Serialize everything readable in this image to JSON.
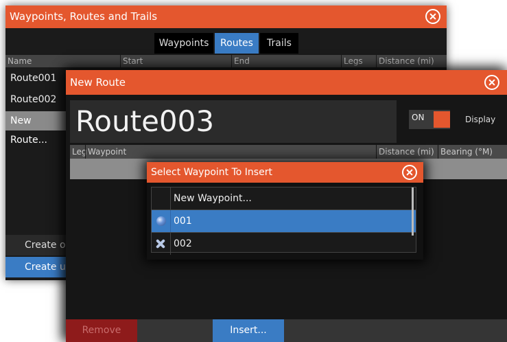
{
  "routes_dialog": {
    "title": "Waypoints, Routes and Trails",
    "tabs": [
      "Waypoints",
      "Routes",
      "Trails"
    ],
    "active_tab": "Routes",
    "columns": [
      "Name",
      "Start",
      "End",
      "Legs",
      "Distance (mi)"
    ],
    "routes": [
      "Route001",
      "Route002",
      "New Route..."
    ],
    "buttons": [
      "Create o",
      "Create u"
    ]
  },
  "new_route": {
    "title": "New Route",
    "route_name": "Route003",
    "toggle_label": "ON",
    "display_label": "Display",
    "columns": [
      "Leg",
      "Waypoint",
      "Distance (mi)",
      "Bearing (°M)"
    ],
    "remove_label": "Remove",
    "insert_label": "Insert..."
  },
  "select_waypoint": {
    "title": "Select Waypoint To Insert",
    "items": [
      {
        "label": "New Waypoint...",
        "icon": ""
      },
      {
        "label": "001",
        "icon": "waypoint-sphere-icon"
      },
      {
        "label": "002",
        "icon": "waypoint-x-icon"
      }
    ],
    "selected_index": 1
  },
  "colors": {
    "title_bar": "#e4572e",
    "accent_blue": "#3a7cc4",
    "remove_red": "#8e1b1b"
  }
}
